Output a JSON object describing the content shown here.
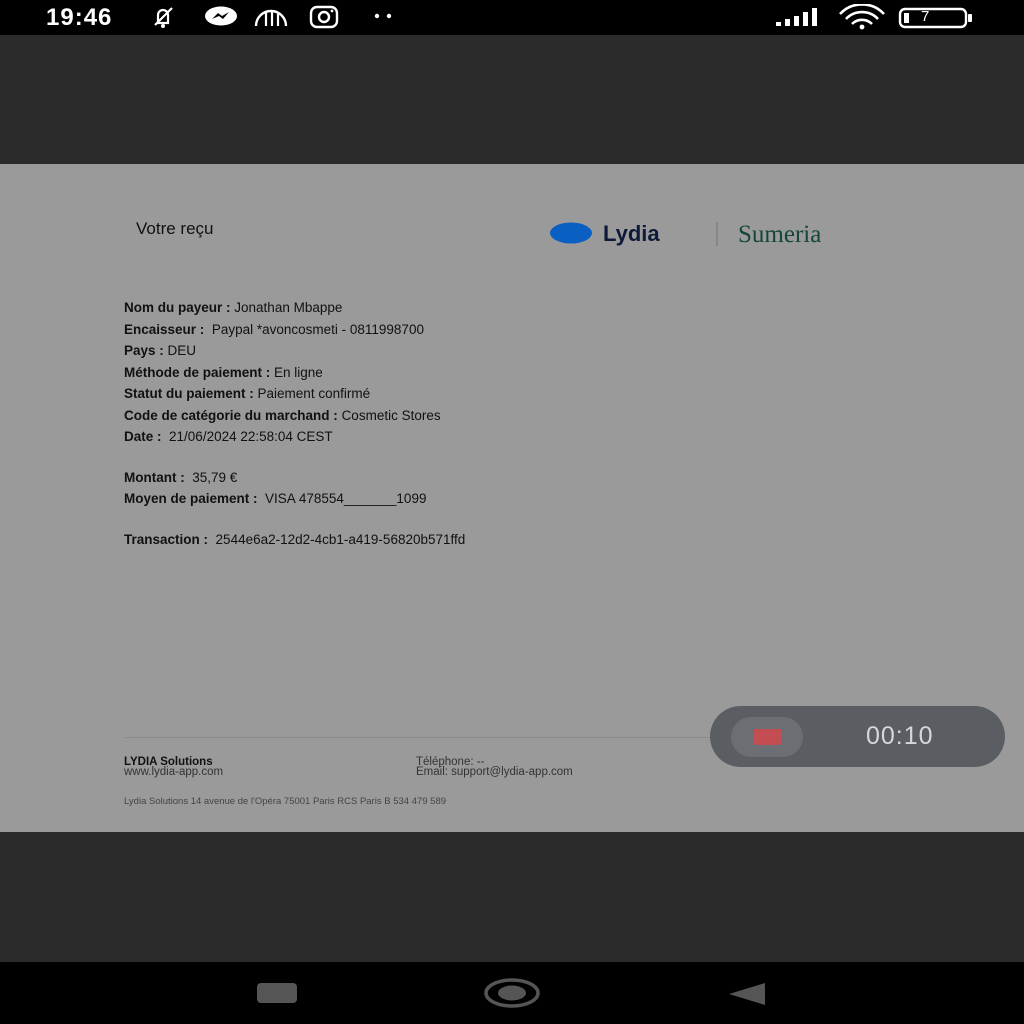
{
  "status_bar": {
    "time": "19:46",
    "battery_level": "7",
    "icons": [
      "bell-off-icon",
      "messenger-icon",
      "restaurant-icon",
      "instagram-icon",
      "more-dots-icon",
      "signal-icon",
      "wifi-icon",
      "battery-icon"
    ]
  },
  "receipt": {
    "title": "Votre reçu",
    "brand_primary": "Lydia",
    "brand_secondary": "Sumeria",
    "fields": [
      {
        "label": "Nom du payeur :",
        "value": "Jonathan Mbappe"
      },
      {
        "label": "Encaisseur :",
        "value": "Paypal *avoncosmeti - 0811998700"
      },
      {
        "label": "Pays :",
        "value": "DEU"
      },
      {
        "label": "Méthode de paiement :",
        "value": "En ligne"
      },
      {
        "label": "Statut du paiement :",
        "value": "Paiement confirmé"
      },
      {
        "label": "Code de catégorie du marchand :",
        "value": "Cosmetic Stores"
      },
      {
        "label": "Date :",
        "value": "21/06/2024 22:58:04 CEST"
      }
    ],
    "amount": {
      "label": "Montant :",
      "value": "35,79 €"
    },
    "payment_method": {
      "label": "Moyen de paiement :",
      "value": "VISA 478554_______1099"
    },
    "transaction": {
      "label": "Transaction :",
      "value": "2544e6a2-12d2-4cb1-a419-56820b571ffd"
    },
    "footer": {
      "company": "LYDIA Solutions",
      "website": "www.lydia-app.com",
      "phone": "Téléphone: --",
      "email": "Email: support@lydia-app.com",
      "address": "Lydia Solutions 14 avenue de l'Opéra 75001 Paris RCS Paris B 534 479 589"
    }
  },
  "recorder": {
    "elapsed": "00:10"
  },
  "colors": {
    "lydia_blue": "#0a5fc2",
    "sumeria_green": "#14463c",
    "record_red": "#c24e53"
  }
}
